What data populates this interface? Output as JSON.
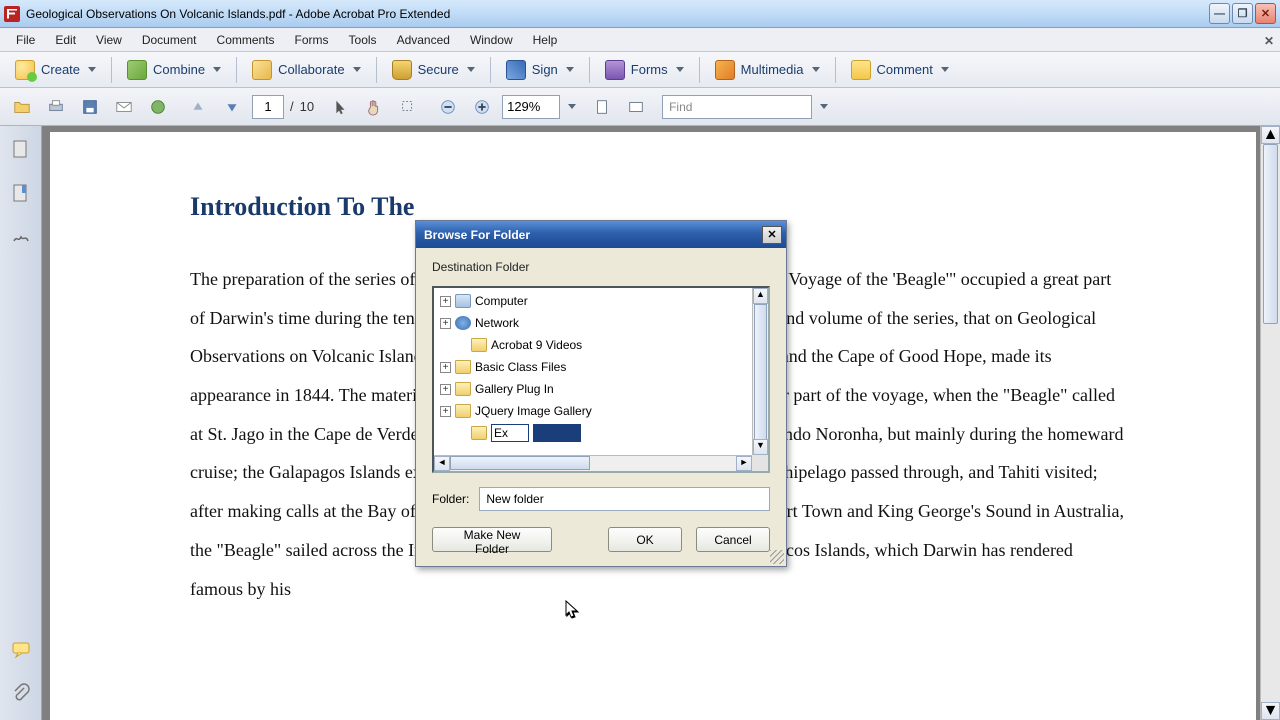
{
  "window": {
    "title": "Geological Observations On Volcanic Islands.pdf - Adobe Acrobat Pro Extended"
  },
  "menu": {
    "items": [
      "File",
      "Edit",
      "View",
      "Document",
      "Comments",
      "Forms",
      "Tools",
      "Advanced",
      "Window",
      "Help"
    ]
  },
  "toolbar1": {
    "create": "Create",
    "combine": "Combine",
    "collaborate": "Collaborate",
    "secure": "Secure",
    "sign": "Sign",
    "forms": "Forms",
    "multimedia": "Multimedia",
    "comment": "Comment"
  },
  "toolbar2": {
    "page_current": "1",
    "page_sep": "/",
    "page_total": "10",
    "zoom": "129%",
    "find_placeholder": "Find"
  },
  "document": {
    "heading": "Introduction To The",
    "body": "The preparation of the series of volumes, published under the title \"Geology of the Voyage of the 'Beagle'\" occupied a great part of Darwin's time during the ten years that followed his return to England. The second volume of the series, that on Geological Observations on Volcanic Islands, with Brief Notices on the Geology of Australia and the Cape of Good Hope, made its appearance in 1844. The materials for this volume were collected during the earlier part of the voyage, when the \"Beagle\" called at St. Jago in the Cape de Verde Archipelago, at a number of spots including Fernando Noronha, but mainly during the homeward cruise; the Galapagos Islands examined, the Pacific Islands surveyed, the Low Archipelago passed through, and Tahiti visited; after making calls at the Bay of Islands, in New Zealand, and also at Sydney, Hobart Town and King George's Sound in Australia, the \"Beagle\" sailed across the Indian Ocean to the little group of the Keeling or Cocos Islands, which Darwin has rendered famous by his"
  },
  "dialog": {
    "title": "Browse For Folder",
    "subtitle": "Destination Folder",
    "tree": {
      "computer": "Computer",
      "network": "Network",
      "items": [
        "Acrobat 9 Videos",
        "Basic Class Files",
        "Gallery Plug In",
        "JQuery Image Gallery"
      ],
      "editing_value": "Ex"
    },
    "folder_label": "Folder:",
    "folder_value": "New folder",
    "btn_make": "Make New Folder",
    "btn_ok": "OK",
    "btn_cancel": "Cancel"
  }
}
